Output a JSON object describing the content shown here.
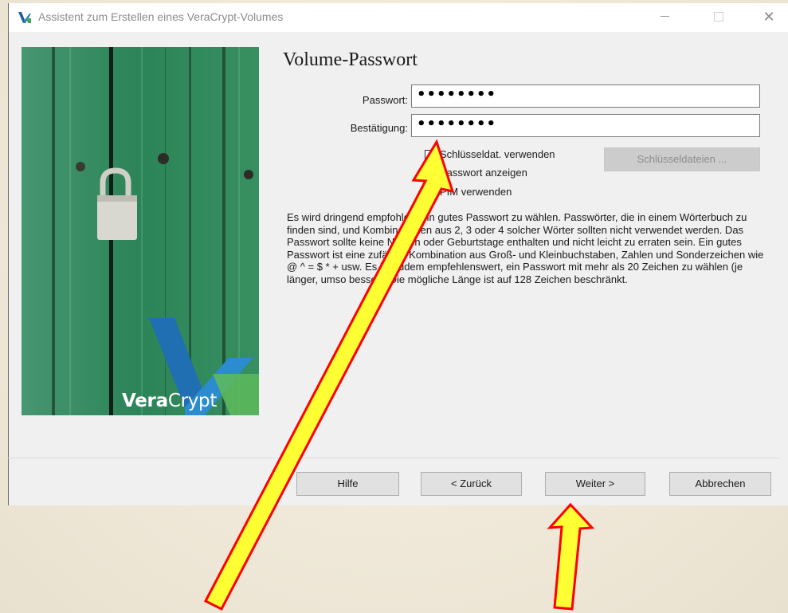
{
  "window": {
    "title": "Assistent zum Erstellen eines VeraCrypt-Volumes",
    "minimize_glyph": "minimize-icon",
    "maximize_glyph": "maximize-icon",
    "close_glyph": "✕"
  },
  "logo": {
    "bold": "Vera",
    "regular": "Crypt"
  },
  "heading": "Volume-Passwort",
  "password": {
    "label": "Passwort:",
    "value": "••••••••"
  },
  "confirm": {
    "label": "Bestätigung:",
    "value": "••••••••"
  },
  "options": {
    "use_keyfiles": "Schlüsseldat. verwenden",
    "show_password": "Passwort anzeigen",
    "use_pim": "PIM verwenden"
  },
  "keyfiles_button": "Schlüsseldateien ...",
  "info_text": "Es wird dringend empfohlen, ein gutes Passwort zu wählen. Passwörter, die in einem Wörterbuch zu finden sind, und Kombinationen aus 2, 3 oder 4 solcher Wörter sollten nicht verwendet werden. Das Passwort sollte keine Namen oder Geburtstage enthalten und nicht leicht zu erraten sein. Ein gutes Passwort ist eine zufällige Kombination aus Groß- und Kleinbuchstaben, Zahlen und Sonderzeichen wie @ ^ = $ * + usw. Es ist zudem empfehlenswert, ein Passwort mit mehr als 20 Zeichen zu wählen (je länger, umso besser). Die mögliche Länge ist auf 128 Zeichen beschränkt.",
  "buttons": {
    "help": "Hilfe",
    "back": "< Zurück",
    "next": "Weiter >",
    "cancel": "Abbrechen"
  },
  "colors": {
    "arrow_fill": "#ffff33",
    "arrow_stroke": "#ff0000",
    "door_green": "#2f8a5a"
  }
}
